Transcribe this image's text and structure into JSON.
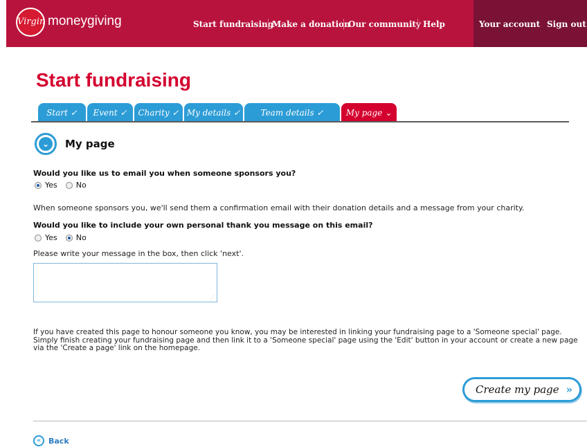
{
  "header": {
    "logo_text": "Virgin",
    "brand": "moneygiving",
    "nav": [
      "Start fundraising",
      "Make a donation",
      "Our community",
      "Help"
    ],
    "account": [
      "Your account",
      "Sign out"
    ]
  },
  "page_title": "Start fundraising",
  "tabs": [
    {
      "label": "Start ✓"
    },
    {
      "label": "Event ✓"
    },
    {
      "label": "Charity ✓"
    },
    {
      "label": "My details ✓"
    },
    {
      "label": "Team details   ✓"
    },
    {
      "label": "My page ⌄"
    }
  ],
  "section": {
    "title": "My page"
  },
  "q1": {
    "label": "Would you like us to email you when someone sponsors you?",
    "options": [
      "Yes",
      "No"
    ],
    "selected": "Yes"
  },
  "confirmation_text": "When someone sponsors you, we'll send them a confirmation email with their donation details and a message from your charity.",
  "q2": {
    "label": "Would you like to include your own personal thank you message on this email?",
    "options": [
      "Yes",
      "No"
    ],
    "selected": "No"
  },
  "message_instruction": "Please write your message in the box, then click 'next'.",
  "message_value": "",
  "info_text": "If you have created this page to honour someone you know, you may be interested in linking your fundraising page to a 'Someone special' page. Simply finish creating your fundraising page and then link it to a 'Someone special' page using the 'Edit' button in your account or create a new page via the 'Create a page' link on the homepage.",
  "buttons": {
    "create": "Create my page",
    "back": "Back"
  },
  "colors": {
    "brand_red": "#b8133d",
    "account_bg": "#7a1236",
    "tab_blue": "#2c9cd6",
    "title_red": "#d4002e"
  }
}
